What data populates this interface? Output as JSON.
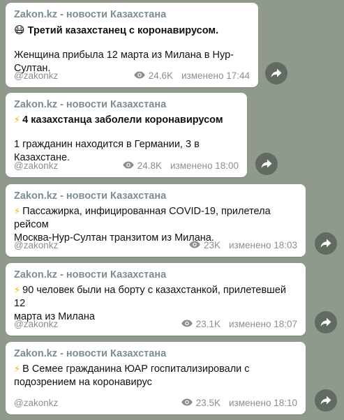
{
  "posts": [
    {
      "channel": "Zakon.kz - новости Казахстана",
      "emoji": "😷",
      "headline": "Третий казахстанец с коронавирусом.",
      "body": "Женщина прибыла 12 марта из Милана в Нур-Султан.",
      "handle": "@zakonkz",
      "views": "24.6K",
      "edited": "изменено 17:44"
    },
    {
      "channel": "Zakon.kz - новости Казахстана",
      "emoji": "⚡",
      "headline": "4 казахстанца заболели коронавирусом",
      "body": "1 гражданин находится в Германии, 3 в Казахстане.",
      "handle": "@zakonkz",
      "views": "24.8K",
      "edited": "изменено 18:00"
    },
    {
      "channel": "Zakon.kz - новости Казахстана",
      "emoji": "⚡",
      "text_line1": "Пассажирка, инфицированная COVID-19, прилетела рейсом",
      "text_line2": "Москва-Нур-Султан транзитом из Милана.",
      "handle": "@zakonkz",
      "views": "23K",
      "edited": "изменено 18:03"
    },
    {
      "channel": "Zakon.kz - новости Казахстана",
      "emoji": "⚡",
      "text_line1": "90 человек были на борту с казахстанкой, прилетевшей 12",
      "text_line2": "марта из Милана",
      "handle": "@zakonkz",
      "views": "23.1K",
      "edited": "изменено 18:07"
    },
    {
      "channel": "Zakon.kz - новости Казахстана",
      "emoji": "⚡",
      "text_line1": "В Семее гражданина ЮАР госпитализировали с",
      "text_line2": "подозрением на коронавирус",
      "handle": "@zakonkz",
      "views": "23.5K",
      "edited": "изменено 18:10"
    }
  ],
  "icons": {
    "views": "eye-icon",
    "share": "share-arrow-icon"
  },
  "colors": {
    "background": "#8f9a8d",
    "channel_name": "#7d8c92",
    "meta": "#8a8f93",
    "bolt": "#f5b400"
  }
}
